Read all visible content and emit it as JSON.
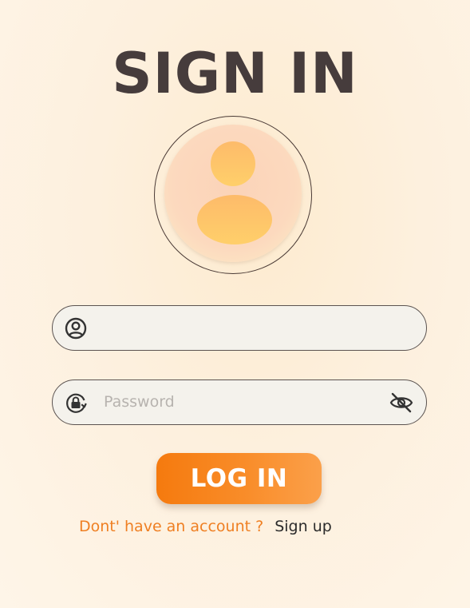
{
  "page": {
    "title": "SIGN IN"
  },
  "form": {
    "username": {
      "placeholder": "",
      "value": "",
      "icon": "user-circle-icon"
    },
    "password": {
      "placeholder": "Password",
      "value": "",
      "icon": "lock-refresh-icon",
      "toggle_icon": "eye-off-icon"
    },
    "login_label": "LOG IN"
  },
  "footer": {
    "question": "Dont' have an account ?",
    "signup_label": "Sign up"
  },
  "colors": {
    "accent": "#f57a0e",
    "title": "#463c3c",
    "link_question": "#ef7f22"
  }
}
